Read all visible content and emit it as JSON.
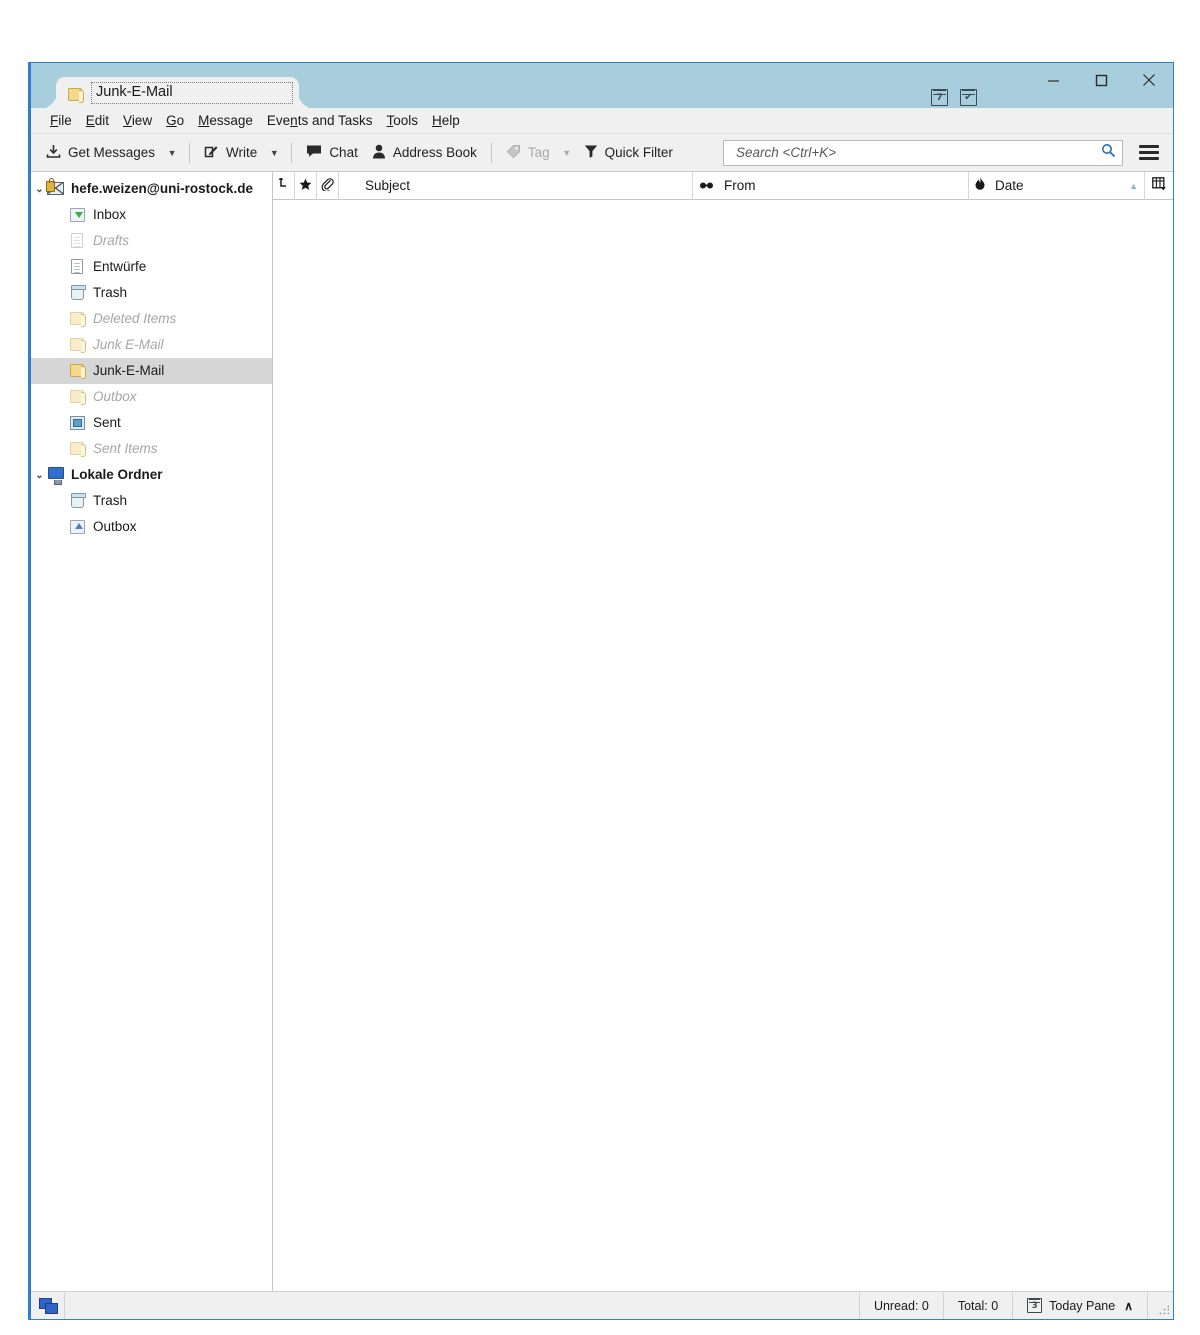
{
  "window": {
    "tab_label": "Junk-E-Mail",
    "tab_icon": "folder-icon",
    "titlebar_icons": [
      {
        "name": "calendar-icon",
        "glyph": "7"
      },
      {
        "name": "tasks-icon",
        "glyph": "✔"
      }
    ],
    "controls": {
      "minimize": "minimize-button",
      "maximize": "maximize-button",
      "close": "close-button"
    }
  },
  "menubar": {
    "items": [
      {
        "label": "File",
        "accel": "F"
      },
      {
        "label": "Edit",
        "accel": "E"
      },
      {
        "label": "View",
        "accel": "V"
      },
      {
        "label": "Go",
        "accel": "G"
      },
      {
        "label": "Message",
        "accel": "M"
      },
      {
        "label": "Events and Tasks",
        "accel": "n"
      },
      {
        "label": "Tools",
        "accel": "T"
      },
      {
        "label": "Help",
        "accel": "H"
      }
    ]
  },
  "toolbar": {
    "get_messages": "Get Messages",
    "write": "Write",
    "chat": "Chat",
    "address_book": "Address Book",
    "tag": "Tag",
    "quick_filter": "Quick Filter",
    "search_placeholder": "Search <Ctrl+K>",
    "search_value": "",
    "icons": {
      "get_messages": "download-icon",
      "write": "compose-pencil-icon",
      "chat": "chat-bubble-icon",
      "address_book": "person-icon",
      "tag": "tag-icon",
      "quick_filter": "funnel-icon",
      "search": "search-icon",
      "app_menu": "hamburger-menu-icon"
    }
  },
  "sidebar": {
    "items": [
      {
        "label": "hefe.weizen@uni-rostock.de",
        "icon": "account-secure-mail-icon",
        "level": 0,
        "type": "account",
        "expanded": true,
        "state": "normal"
      },
      {
        "label": "Inbox",
        "icon": "inbox-icon",
        "level": 1,
        "type": "folder",
        "state": "normal"
      },
      {
        "label": "Drafts",
        "icon": "drafts-icon",
        "level": 1,
        "type": "folder",
        "state": "dim"
      },
      {
        "label": "Entwürfe",
        "icon": "drafts-icon",
        "level": 1,
        "type": "folder",
        "state": "normal"
      },
      {
        "label": "Trash",
        "icon": "trash-icon",
        "level": 1,
        "type": "folder",
        "state": "normal"
      },
      {
        "label": "Deleted Items",
        "icon": "folder-icon",
        "level": 1,
        "type": "folder",
        "state": "dim"
      },
      {
        "label": "Junk E-Mail",
        "icon": "folder-icon",
        "level": 1,
        "type": "folder",
        "state": "dim"
      },
      {
        "label": "Junk-E-Mail",
        "icon": "folder-icon",
        "level": 1,
        "type": "folder",
        "state": "selected"
      },
      {
        "label": "Outbox",
        "icon": "folder-icon",
        "level": 1,
        "type": "folder",
        "state": "dim"
      },
      {
        "label": "Sent",
        "icon": "sent-icon",
        "level": 1,
        "type": "folder",
        "state": "normal"
      },
      {
        "label": "Sent Items",
        "icon": "folder-icon",
        "level": 1,
        "type": "folder",
        "state": "dim"
      },
      {
        "label": "Lokale Ordner",
        "icon": "local-folders-icon",
        "level": 0,
        "type": "account",
        "expanded": true,
        "state": "normal"
      },
      {
        "label": "Trash",
        "icon": "trash-icon",
        "level": 1,
        "type": "folder",
        "state": "normal"
      },
      {
        "label": "Outbox",
        "icon": "outbox-icon",
        "level": 1,
        "type": "folder",
        "state": "normal"
      }
    ]
  },
  "message_list": {
    "columns": [
      {
        "key": "thread",
        "label": "",
        "icon": "thread-icon"
      },
      {
        "key": "starred",
        "label": "",
        "icon": "star-icon"
      },
      {
        "key": "attachment",
        "label": "",
        "icon": "paperclip-icon"
      },
      {
        "key": "subject",
        "label": "Subject",
        "icon": ""
      },
      {
        "key": "from",
        "label": "From",
        "icon": "read-status-icon"
      },
      {
        "key": "date",
        "label": "Date",
        "icon": "flame-icon",
        "sorted": "ascending"
      },
      {
        "key": "picker",
        "label": "",
        "icon": "column-picker-icon"
      }
    ],
    "rows": []
  },
  "statusbar": {
    "network_icon": "network-icon",
    "unread": "Unread: 0",
    "total": "Total: 0",
    "today_pane": "Today Pane",
    "today_pane_icon_glyph": "3",
    "today_pane_chevron": "∧"
  }
}
